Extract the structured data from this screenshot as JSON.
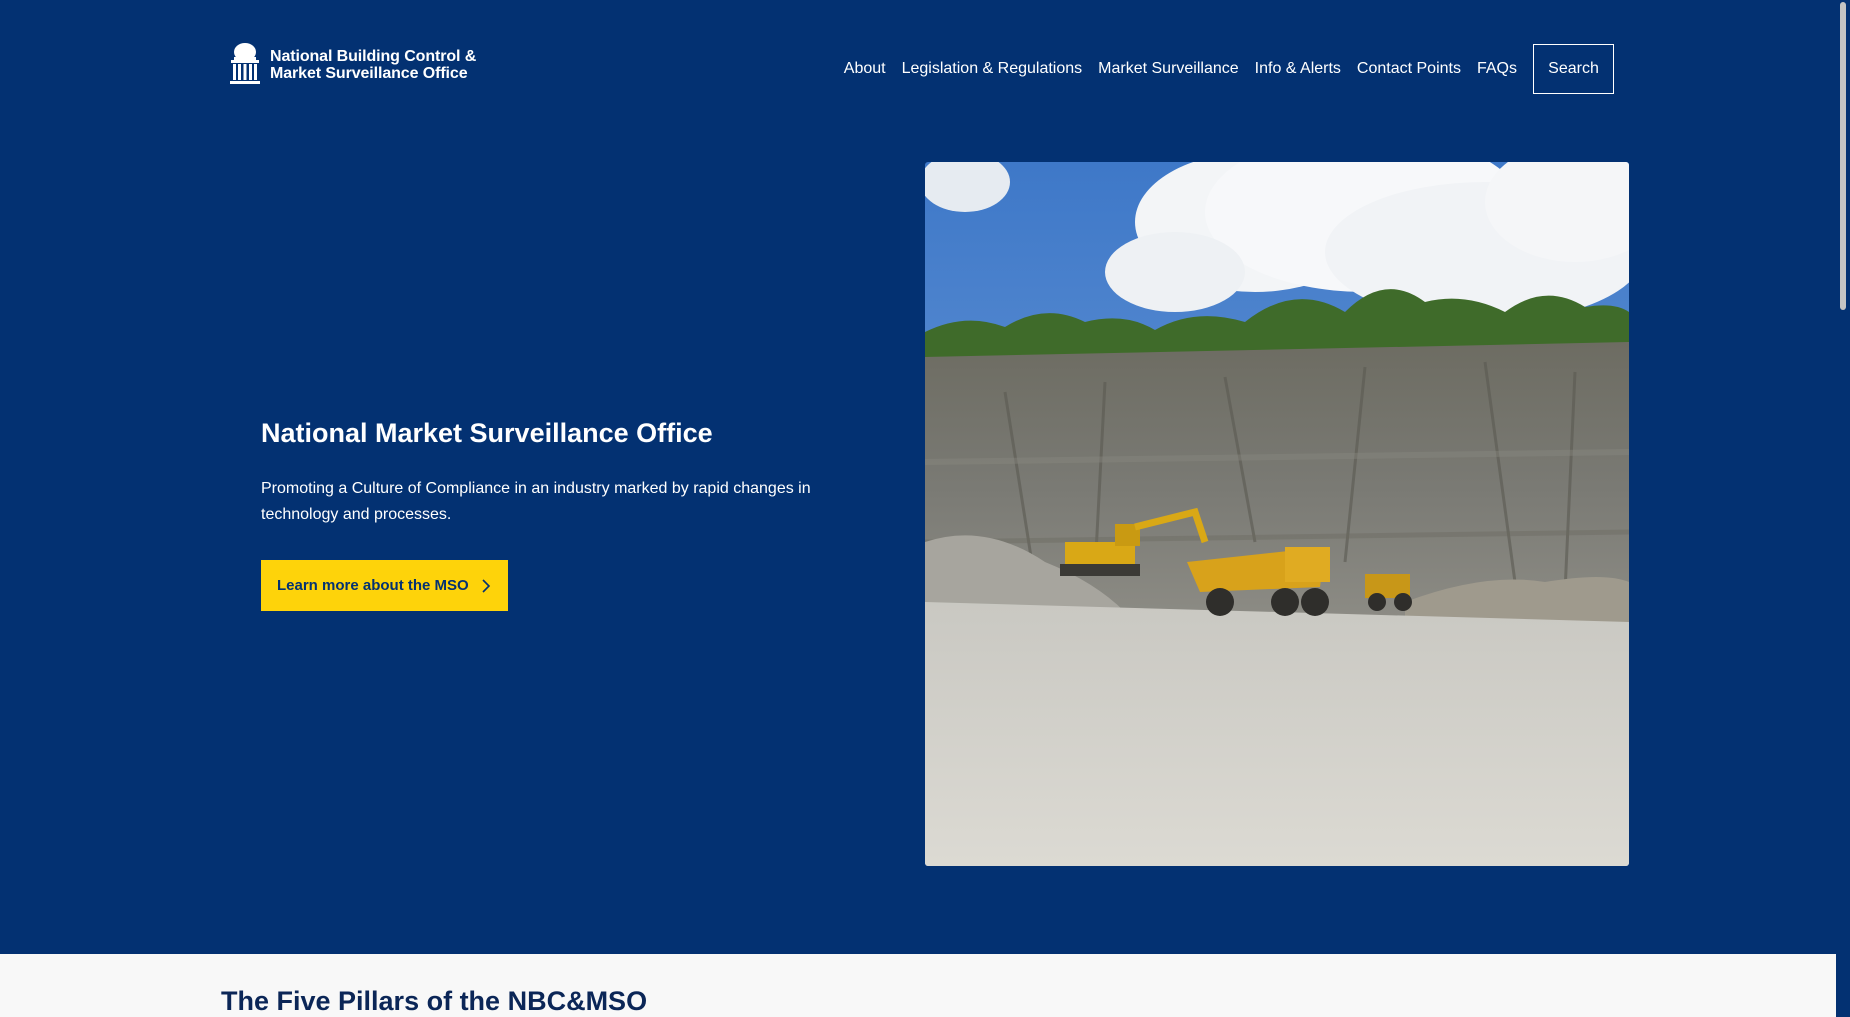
{
  "header": {
    "logo_line1": "National Building Control &",
    "logo_line2": "Market Surveillance Office",
    "nav": [
      "About",
      "Legislation & Regulations",
      "Market Surveillance",
      "Info & Alerts",
      "Contact Points",
      "FAQs"
    ],
    "search_label": "Search"
  },
  "hero": {
    "title": "National Market Surveillance Office",
    "description": "Promoting a Culture of Compliance in an industry marked by rapid changes in technology and processes.",
    "cta_label": "Learn more about the MSO",
    "image_icon": "quarry-excavator-dump-truck-photo"
  },
  "pillars": {
    "title": "The Five Pillars of the NBC&MSO"
  },
  "colors": {
    "background": "#033172",
    "accent": "#fed30a",
    "section_bg": "#f8f8f8",
    "heading_dark": "#0b2657"
  }
}
